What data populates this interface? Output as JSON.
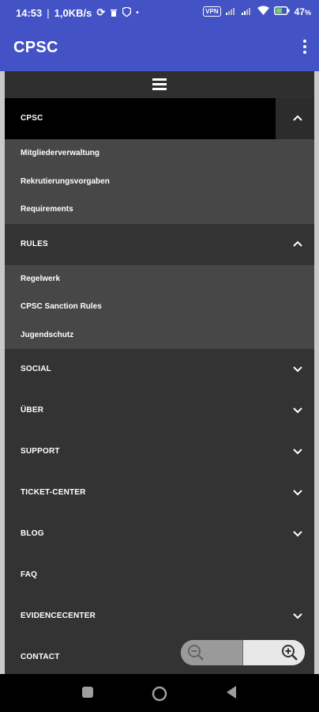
{
  "status_bar": {
    "time": "14:53",
    "network_speed": "1,0KB/s",
    "vpn_label": "VPN",
    "battery": "47"
  },
  "app_bar": {
    "title": "CPSC"
  },
  "menu": {
    "sections": [
      {
        "label": "CPSC",
        "expanded": true,
        "items": [
          "Mitgliederverwaltung",
          "Rekrutierungsvorgaben",
          "Requirements"
        ]
      },
      {
        "label": "RULES",
        "expanded": true,
        "items": [
          "Regelwerk",
          "CPSC Sanction Rules",
          "Jugendschutz"
        ]
      },
      {
        "label": "SOCIAL",
        "expanded": false
      },
      {
        "label": "ÜBER",
        "expanded": false
      },
      {
        "label": "SUPPORT",
        "expanded": false
      },
      {
        "label": "TICKET-CENTER",
        "expanded": false
      },
      {
        "label": "BLOG",
        "expanded": false
      },
      {
        "label": "FAQ",
        "expanded": false
      },
      {
        "label": "EVIDENCECENTER",
        "expanded": false
      },
      {
        "label": "CONTACT",
        "expanded": false
      }
    ]
  },
  "colors": {
    "app_bar": "#4352c4",
    "menu_bg": "#333333",
    "submenu_bg": "#474747"
  }
}
